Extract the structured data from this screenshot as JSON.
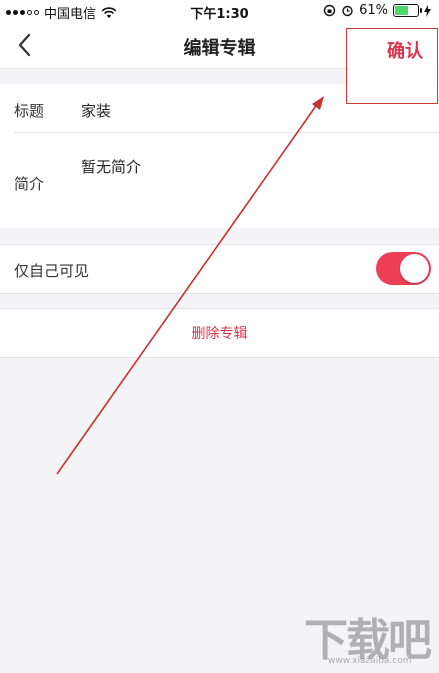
{
  "status_bar": {
    "carrier": "中国电信",
    "time": "下午1:30",
    "battery_percent": "61%",
    "battery_level": 0.61
  },
  "nav": {
    "back_icon": "chevron-left-icon",
    "title": "编辑专辑",
    "confirm_label": "确认"
  },
  "form": {
    "title_label": "标题",
    "title_value": "家装",
    "intro_label": "简介",
    "intro_value": "暂无简介"
  },
  "privacy": {
    "label": "仅自己可见",
    "enabled": true
  },
  "actions": {
    "delete_label": "删除专辑"
  },
  "watermark": {
    "brand": "下载吧",
    "url": "www.xiazaiba.com"
  },
  "colors": {
    "accent": "#d8344c",
    "toggle_on": "#ec3f55",
    "annotation": "#d43a3a",
    "background": "#f4f3f6"
  }
}
